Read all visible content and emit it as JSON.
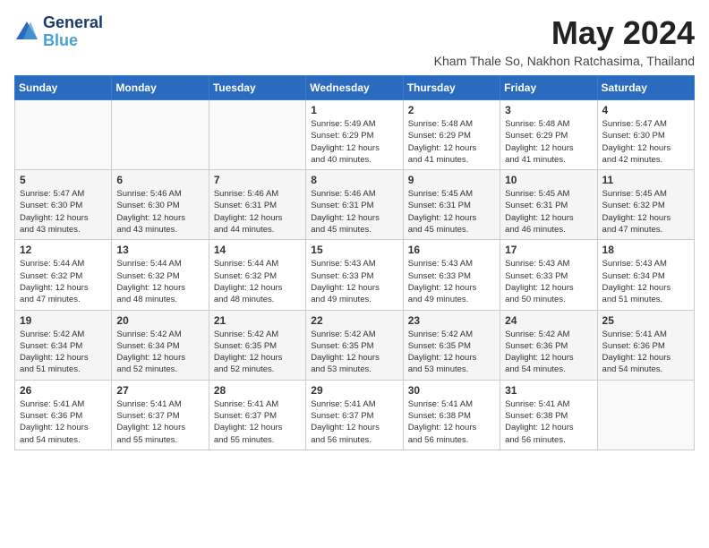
{
  "header": {
    "logo_line1": "General",
    "logo_line2": "Blue",
    "month": "May 2024",
    "location": "Kham Thale So, Nakhon Ratchasima, Thailand"
  },
  "weekdays": [
    "Sunday",
    "Monday",
    "Tuesday",
    "Wednesday",
    "Thursday",
    "Friday",
    "Saturday"
  ],
  "weeks": [
    [
      {
        "day": "",
        "info": ""
      },
      {
        "day": "",
        "info": ""
      },
      {
        "day": "",
        "info": ""
      },
      {
        "day": "1",
        "info": "Sunrise: 5:49 AM\nSunset: 6:29 PM\nDaylight: 12 hours\nand 40 minutes."
      },
      {
        "day": "2",
        "info": "Sunrise: 5:48 AM\nSunset: 6:29 PM\nDaylight: 12 hours\nand 41 minutes."
      },
      {
        "day": "3",
        "info": "Sunrise: 5:48 AM\nSunset: 6:29 PM\nDaylight: 12 hours\nand 41 minutes."
      },
      {
        "day": "4",
        "info": "Sunrise: 5:47 AM\nSunset: 6:30 PM\nDaylight: 12 hours\nand 42 minutes."
      }
    ],
    [
      {
        "day": "5",
        "info": "Sunrise: 5:47 AM\nSunset: 6:30 PM\nDaylight: 12 hours\nand 43 minutes."
      },
      {
        "day": "6",
        "info": "Sunrise: 5:46 AM\nSunset: 6:30 PM\nDaylight: 12 hours\nand 43 minutes."
      },
      {
        "day": "7",
        "info": "Sunrise: 5:46 AM\nSunset: 6:31 PM\nDaylight: 12 hours\nand 44 minutes."
      },
      {
        "day": "8",
        "info": "Sunrise: 5:46 AM\nSunset: 6:31 PM\nDaylight: 12 hours\nand 45 minutes."
      },
      {
        "day": "9",
        "info": "Sunrise: 5:45 AM\nSunset: 6:31 PM\nDaylight: 12 hours\nand 45 minutes."
      },
      {
        "day": "10",
        "info": "Sunrise: 5:45 AM\nSunset: 6:31 PM\nDaylight: 12 hours\nand 46 minutes."
      },
      {
        "day": "11",
        "info": "Sunrise: 5:45 AM\nSunset: 6:32 PM\nDaylight: 12 hours\nand 47 minutes."
      }
    ],
    [
      {
        "day": "12",
        "info": "Sunrise: 5:44 AM\nSunset: 6:32 PM\nDaylight: 12 hours\nand 47 minutes."
      },
      {
        "day": "13",
        "info": "Sunrise: 5:44 AM\nSunset: 6:32 PM\nDaylight: 12 hours\nand 48 minutes."
      },
      {
        "day": "14",
        "info": "Sunrise: 5:44 AM\nSunset: 6:32 PM\nDaylight: 12 hours\nand 48 minutes."
      },
      {
        "day": "15",
        "info": "Sunrise: 5:43 AM\nSunset: 6:33 PM\nDaylight: 12 hours\nand 49 minutes."
      },
      {
        "day": "16",
        "info": "Sunrise: 5:43 AM\nSunset: 6:33 PM\nDaylight: 12 hours\nand 49 minutes."
      },
      {
        "day": "17",
        "info": "Sunrise: 5:43 AM\nSunset: 6:33 PM\nDaylight: 12 hours\nand 50 minutes."
      },
      {
        "day": "18",
        "info": "Sunrise: 5:43 AM\nSunset: 6:34 PM\nDaylight: 12 hours\nand 51 minutes."
      }
    ],
    [
      {
        "day": "19",
        "info": "Sunrise: 5:42 AM\nSunset: 6:34 PM\nDaylight: 12 hours\nand 51 minutes."
      },
      {
        "day": "20",
        "info": "Sunrise: 5:42 AM\nSunset: 6:34 PM\nDaylight: 12 hours\nand 52 minutes."
      },
      {
        "day": "21",
        "info": "Sunrise: 5:42 AM\nSunset: 6:35 PM\nDaylight: 12 hours\nand 52 minutes."
      },
      {
        "day": "22",
        "info": "Sunrise: 5:42 AM\nSunset: 6:35 PM\nDaylight: 12 hours\nand 53 minutes."
      },
      {
        "day": "23",
        "info": "Sunrise: 5:42 AM\nSunset: 6:35 PM\nDaylight: 12 hours\nand 53 minutes."
      },
      {
        "day": "24",
        "info": "Sunrise: 5:42 AM\nSunset: 6:36 PM\nDaylight: 12 hours\nand 54 minutes."
      },
      {
        "day": "25",
        "info": "Sunrise: 5:41 AM\nSunset: 6:36 PM\nDaylight: 12 hours\nand 54 minutes."
      }
    ],
    [
      {
        "day": "26",
        "info": "Sunrise: 5:41 AM\nSunset: 6:36 PM\nDaylight: 12 hours\nand 54 minutes."
      },
      {
        "day": "27",
        "info": "Sunrise: 5:41 AM\nSunset: 6:37 PM\nDaylight: 12 hours\nand 55 minutes."
      },
      {
        "day": "28",
        "info": "Sunrise: 5:41 AM\nSunset: 6:37 PM\nDaylight: 12 hours\nand 55 minutes."
      },
      {
        "day": "29",
        "info": "Sunrise: 5:41 AM\nSunset: 6:37 PM\nDaylight: 12 hours\nand 56 minutes."
      },
      {
        "day": "30",
        "info": "Sunrise: 5:41 AM\nSunset: 6:38 PM\nDaylight: 12 hours\nand 56 minutes."
      },
      {
        "day": "31",
        "info": "Sunrise: 5:41 AM\nSunset: 6:38 PM\nDaylight: 12 hours\nand 56 minutes."
      },
      {
        "day": "",
        "info": ""
      }
    ]
  ]
}
